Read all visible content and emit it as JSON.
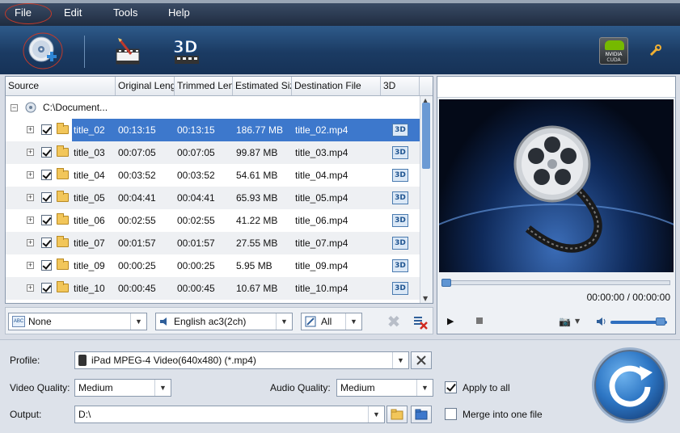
{
  "menu": {
    "file": "File",
    "edit": "Edit",
    "tools": "Tools",
    "help": "Help"
  },
  "toolbar": {
    "add_icon": "add-disc-icon",
    "edit_icon": "clip-edit-icon",
    "threed_label": "3D",
    "nvidia_label": "NVIDIA",
    "cuda_label": "CUDA"
  },
  "columns": [
    "Source",
    "Original Length",
    "Trimmed Length",
    "Estimated Size",
    "Destination File",
    "3D"
  ],
  "root": {
    "label": "C:\\Document..."
  },
  "rows": [
    {
      "name": "title_02",
      "orig": "00:13:15",
      "trim": "00:13:15",
      "size": "186.77 MB",
      "dest": "title_02.mp4"
    },
    {
      "name": "title_03",
      "orig": "00:07:05",
      "trim": "00:07:05",
      "size": "99.87 MB",
      "dest": "title_03.mp4"
    },
    {
      "name": "title_04",
      "orig": "00:03:52",
      "trim": "00:03:52",
      "size": "54.61 MB",
      "dest": "title_04.mp4"
    },
    {
      "name": "title_05",
      "orig": "00:04:41",
      "trim": "00:04:41",
      "size": "65.93 MB",
      "dest": "title_05.mp4"
    },
    {
      "name": "title_06",
      "orig": "00:02:55",
      "trim": "00:02:55",
      "size": "41.22 MB",
      "dest": "title_06.mp4"
    },
    {
      "name": "title_07",
      "orig": "00:01:57",
      "trim": "00:01:57",
      "size": "27.55 MB",
      "dest": "title_07.mp4"
    },
    {
      "name": "title_09",
      "orig": "00:00:25",
      "trim": "00:00:25",
      "size": "5.95 MB",
      "dest": "title_09.mp4"
    },
    {
      "name": "title_10",
      "orig": "00:00:45",
      "trim": "00:00:45",
      "size": "10.67 MB",
      "dest": "title_10.mp4"
    }
  ],
  "row_3d_label": "3D",
  "subtitle": {
    "value": "None",
    "icon": "subtitle-icon"
  },
  "audio": {
    "value": "English ac3(2ch)",
    "icon": "speaker-icon"
  },
  "merge_filter": {
    "value": "All",
    "icon": "merge-icon"
  },
  "preview": {
    "timecode": "00:00:00 / 00:00:00",
    "seek_fraction": 0.0,
    "volume_fraction": 1.0
  },
  "settings": {
    "profile_label": "Profile:",
    "profile_value": "iPad MPEG-4 Video(640x480) (*.mp4)",
    "video_quality_label": "Video Quality:",
    "video_quality_value": "Medium",
    "audio_quality_label": "Audio Quality:",
    "audio_quality_value": "Medium",
    "apply_all_label": "Apply to all",
    "apply_all_checked": true,
    "output_label": "Output:",
    "output_value": "D:\\",
    "merge_label": "Merge into one file",
    "merge_checked": false
  }
}
